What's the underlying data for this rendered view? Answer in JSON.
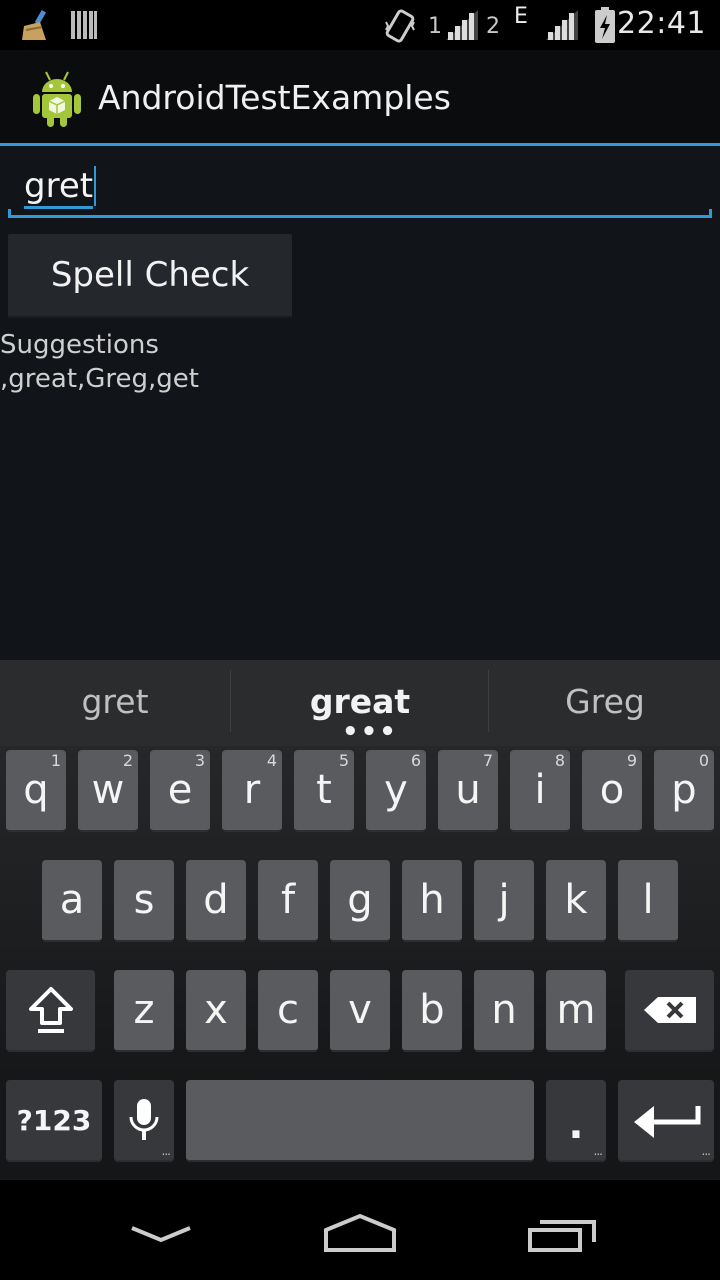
{
  "status_bar": {
    "time": "22:41",
    "sim1_label": "1",
    "sim2_label": "2",
    "network_type": "E",
    "icons": [
      "cleaner-icon",
      "barcode-icon",
      "vibrate-icon",
      "signal-icon",
      "battery-charging-icon"
    ]
  },
  "action_bar": {
    "title": "AndroidTestExamples",
    "logo_icon": "android-logo-icon"
  },
  "main": {
    "input_value": "gret",
    "spell_check_button": "Spell Check",
    "suggestions_label": "Suggestions",
    "suggestions_text": ",great,Greg,get"
  },
  "keyboard": {
    "suggestions": [
      "gret",
      "great",
      "Greg"
    ],
    "suggestion_more": "•••",
    "row1": [
      {
        "label": "q",
        "num": "1"
      },
      {
        "label": "w",
        "num": "2"
      },
      {
        "label": "e",
        "num": "3"
      },
      {
        "label": "r",
        "num": "4"
      },
      {
        "label": "t",
        "num": "5"
      },
      {
        "label": "y",
        "num": "6"
      },
      {
        "label": "u",
        "num": "7"
      },
      {
        "label": "i",
        "num": "8"
      },
      {
        "label": "o",
        "num": "9"
      },
      {
        "label": "p",
        "num": "0"
      }
    ],
    "row2": [
      "a",
      "s",
      "d",
      "f",
      "g",
      "h",
      "j",
      "k",
      "l"
    ],
    "row3": [
      "z",
      "x",
      "c",
      "v",
      "b",
      "n",
      "m"
    ],
    "symbols_key": "?123",
    "period_key": ".",
    "more_marker": "..."
  },
  "colors": {
    "accent": "#2f9ad6",
    "background": "#111418",
    "key": "#5a5b5e",
    "key_dark": "#37383b"
  }
}
